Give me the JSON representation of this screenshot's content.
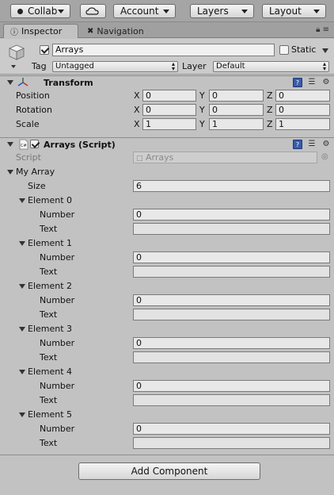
{
  "toolbar": {
    "collab_label": "Collab",
    "account_label": "Account",
    "layers_label": "Layers",
    "layout_label": "Layout"
  },
  "tabs": {
    "inspector": "Inspector",
    "navigation": "Navigation"
  },
  "object": {
    "name": "Arrays",
    "active": true,
    "static_label": "Static",
    "tag_label": "Tag",
    "tag_value": "Untagged",
    "layer_label": "Layer",
    "layer_value": "Default"
  },
  "transform": {
    "title": "Transform",
    "rows": [
      {
        "label": "Position",
        "x": "0",
        "y": "0",
        "z": "0"
      },
      {
        "label": "Rotation",
        "x": "0",
        "y": "0",
        "z": "0"
      },
      {
        "label": "Scale",
        "x": "1",
        "y": "1",
        "z": "1"
      }
    ],
    "axis_x": "X",
    "axis_y": "Y",
    "axis_z": "Z"
  },
  "script": {
    "title": "Arrays (Script)",
    "script_label": "Script",
    "script_value": "Arrays",
    "array_label": "My Array",
    "size_label": "Size",
    "size_value": "6",
    "number_label": "Number",
    "text_label": "Text",
    "elements": [
      {
        "label": "Element 0",
        "number": "0",
        "text": ""
      },
      {
        "label": "Element 1",
        "number": "0",
        "text": ""
      },
      {
        "label": "Element 2",
        "number": "0",
        "text": ""
      },
      {
        "label": "Element 3",
        "number": "0",
        "text": ""
      },
      {
        "label": "Element 4",
        "number": "0",
        "text": ""
      },
      {
        "label": "Element 5",
        "number": "0",
        "text": ""
      }
    ]
  },
  "add_component_label": "Add Component"
}
